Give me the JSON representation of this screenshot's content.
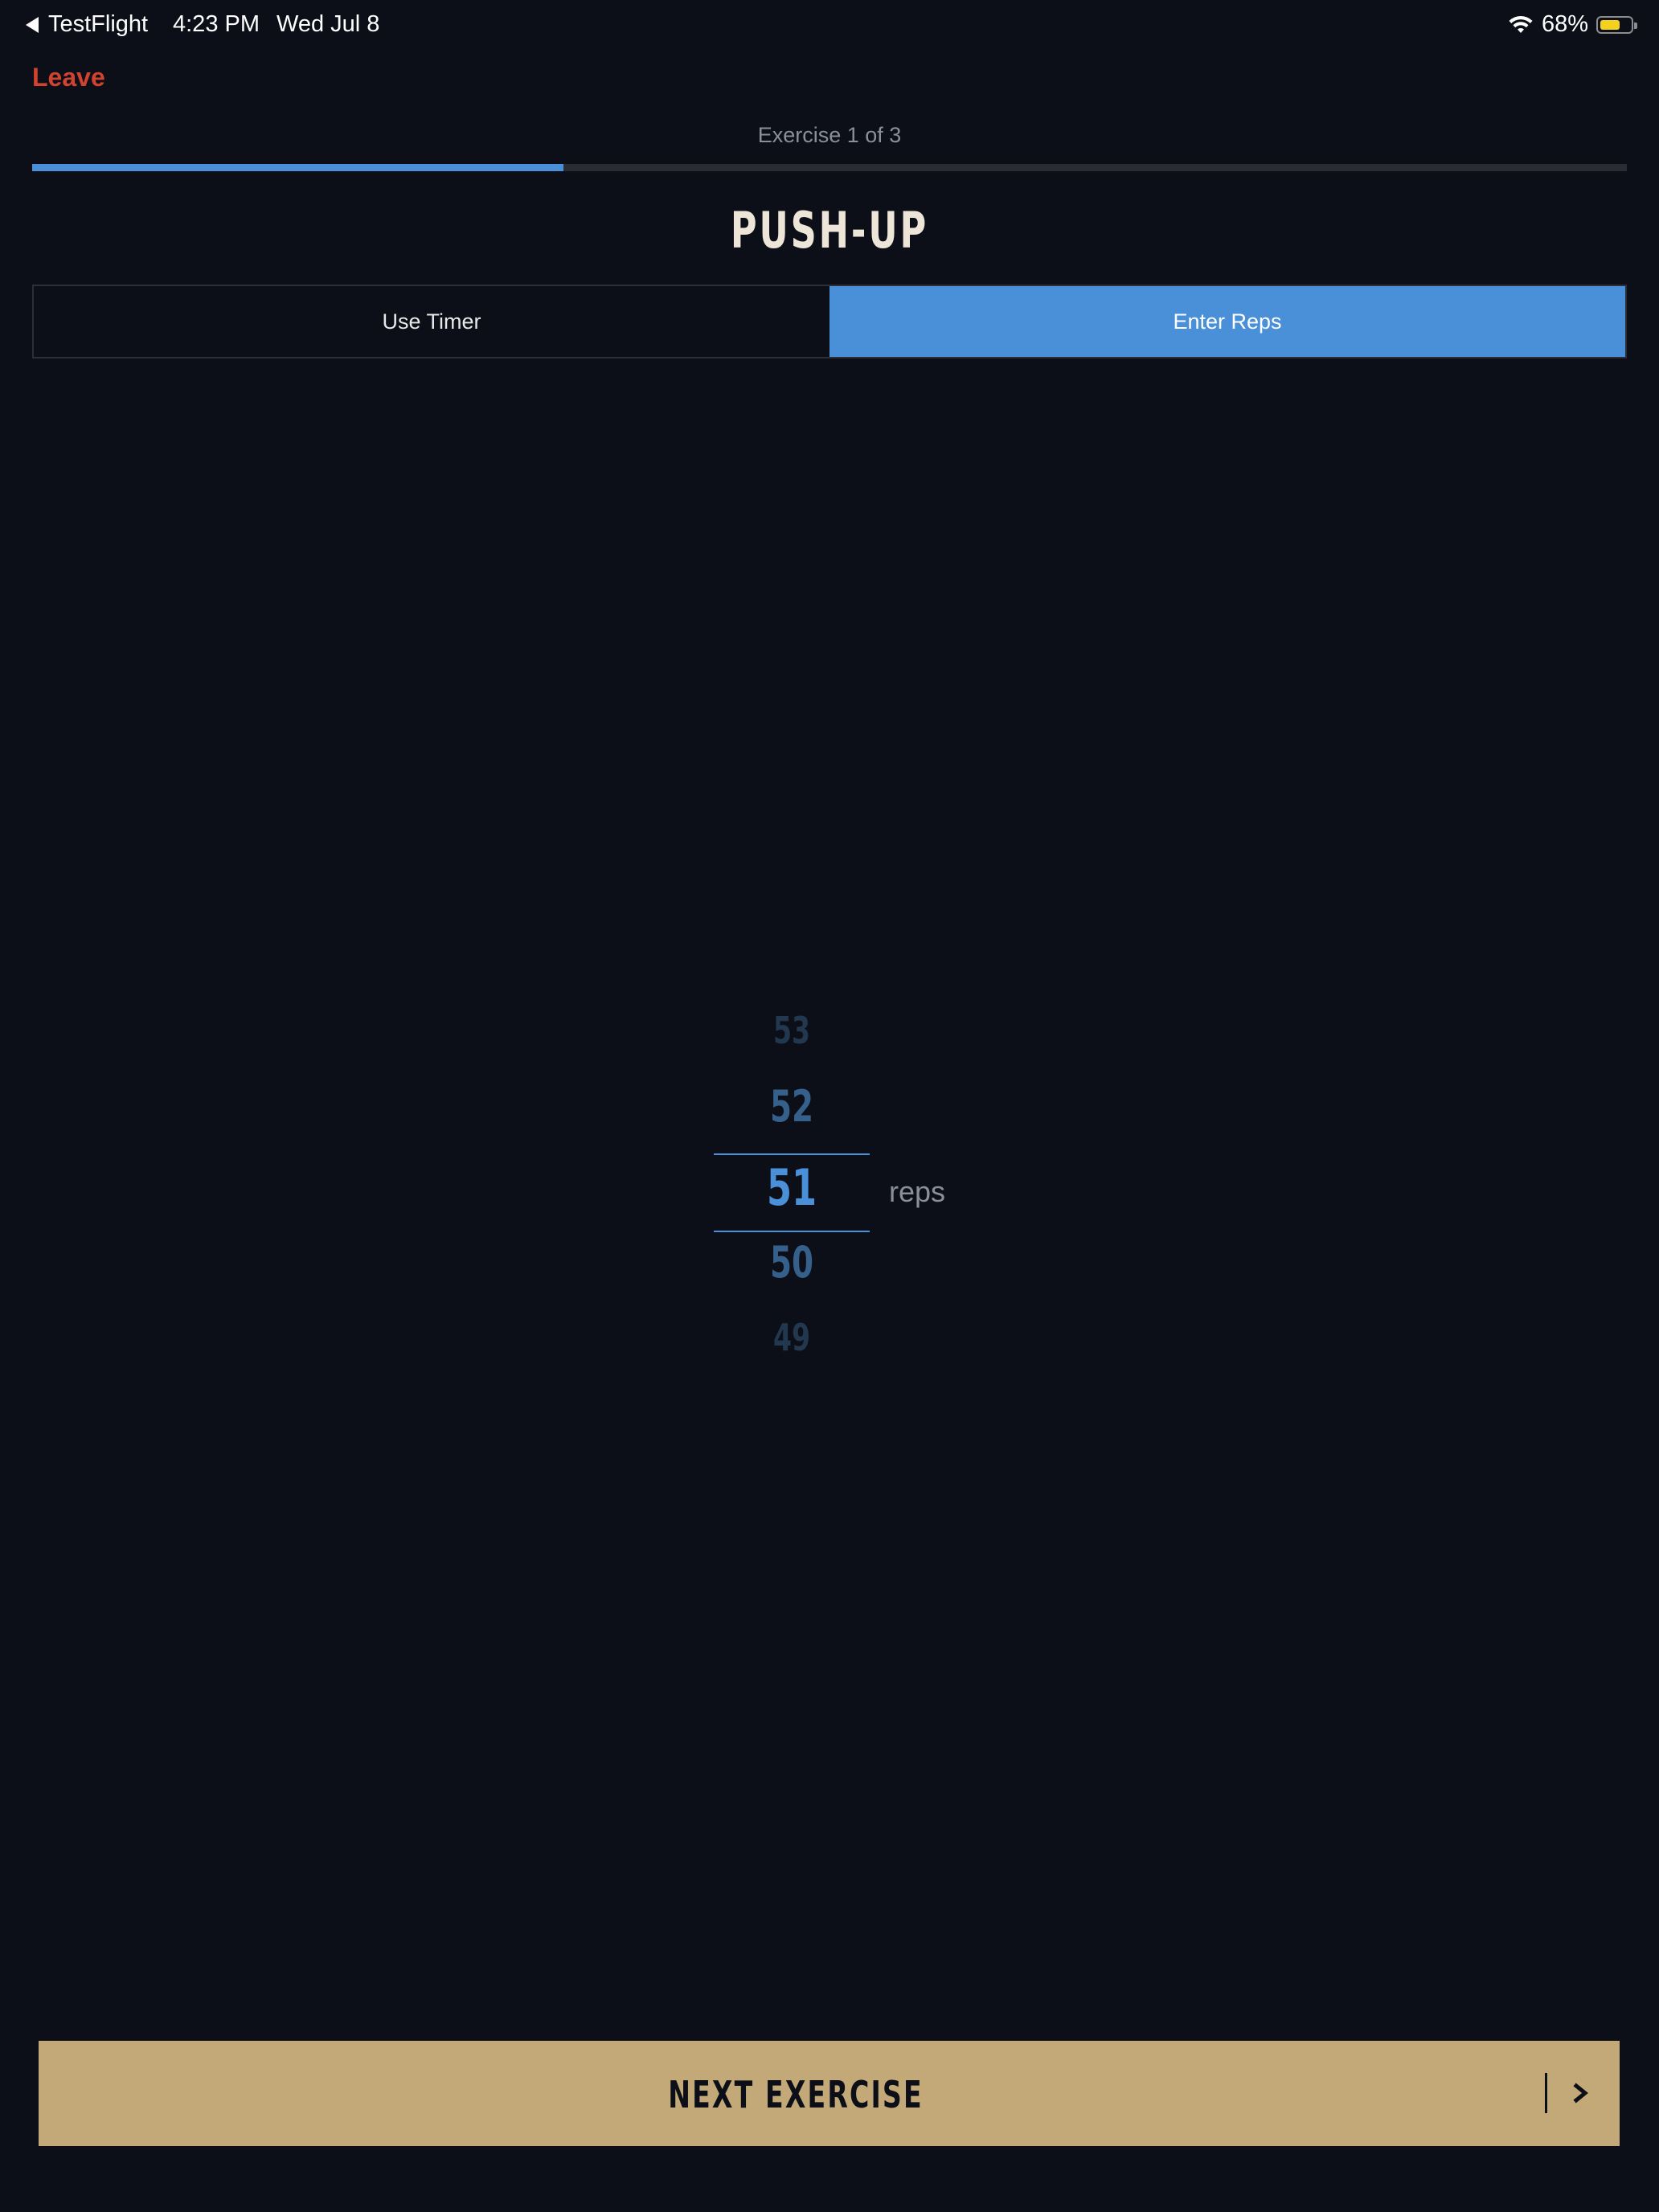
{
  "status_bar": {
    "back_app": "TestFlight",
    "time": "4:23 PM",
    "date": "Wed Jul 8",
    "battery": "68%",
    "battery_level": 0.68,
    "wifi_icon": "wifi-icon",
    "battery_color": "#f4d11d"
  },
  "nav": {
    "leave_label": "Leave"
  },
  "progress": {
    "label": "Exercise 1 of 3",
    "current": 1,
    "total": 3,
    "fraction": 0.333
  },
  "exercise": {
    "title": "PUSH-UP"
  },
  "mode_toggle": {
    "options": [
      "Use Timer",
      "Enter Reps"
    ],
    "selected": "Enter Reps"
  },
  "picker": {
    "values": [
      "53",
      "52",
      "51",
      "50",
      "49"
    ],
    "selected": "51",
    "unit": "reps"
  },
  "footer": {
    "next_label": "NEXT EXERCISE",
    "chevron_icon": "chevron-right-icon"
  },
  "colors": {
    "accent": "#4a90d9",
    "danger": "#d2432f",
    "gold": "#c3a878",
    "background": "#0c0f17"
  }
}
